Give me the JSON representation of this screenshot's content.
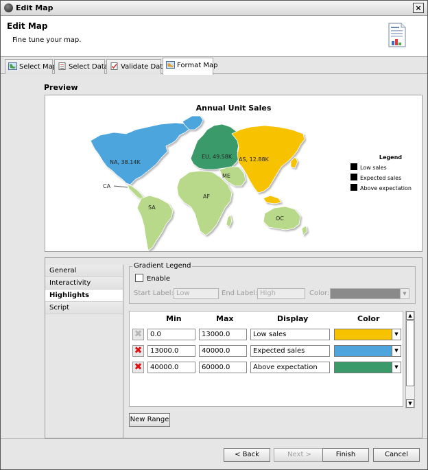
{
  "window": {
    "title": "Edit Map",
    "close_glyph": "×"
  },
  "header": {
    "title": "Edit Map",
    "subtitle": "Fine tune your map."
  },
  "tabs": [
    {
      "label": "Select Map",
      "icon": "map-icon"
    },
    {
      "label": "Select Data",
      "icon": "data-icon"
    },
    {
      "label": "Validate Data",
      "icon": "validate-icon"
    },
    {
      "label": "Format Map",
      "icon": "format-icon",
      "active": true
    }
  ],
  "preview": {
    "label": "Preview",
    "chart_title": "Annual Unit Sales",
    "regions": {
      "na": "NA, 38.14K",
      "eu": "EU, 49.58K",
      "as": "AS, 12.88K",
      "me": "ME",
      "ca": "CA",
      "af": "AF",
      "sa": "SA",
      "oc": "OC"
    },
    "colors": {
      "yellow": "#f7c200",
      "blue": "#4ea5de",
      "green": "#3a9a6a",
      "light_green": "#b9d98a"
    },
    "legend": {
      "title": "Legend",
      "items": [
        "Low sales",
        "Expected sales",
        "Above expectation"
      ]
    }
  },
  "side_list": {
    "items": [
      "General",
      "Interactivity",
      "Highlights",
      "Script"
    ],
    "selected": "Highlights"
  },
  "gradient_legend": {
    "title": "Gradient Legend",
    "enable_label": "Enable",
    "start_label": "Start Label:",
    "start_value": "Low",
    "end_label": "End Label:",
    "end_value": "High",
    "color_label": "Color:"
  },
  "ranges": {
    "headers": {
      "min": "Min",
      "max": "Max",
      "display": "Display",
      "color": "Color"
    },
    "rows": [
      {
        "min": "0.0",
        "max": "13000.0",
        "display": "Low sales",
        "color": "#f7c200",
        "delete_enabled": false
      },
      {
        "min": "13000.0",
        "max": "40000.0",
        "display": "Expected sales",
        "color": "#4ea5de",
        "delete_enabled": true
      },
      {
        "min": "40000.0",
        "max": "60000.0",
        "display": "Above expectation",
        "color": "#3a9a6a",
        "delete_enabled": true
      }
    ],
    "new_range_label": "New Range"
  },
  "footer": {
    "back": "< Back",
    "next": "Next >",
    "finish": "Finish",
    "cancel": "Cancel"
  }
}
